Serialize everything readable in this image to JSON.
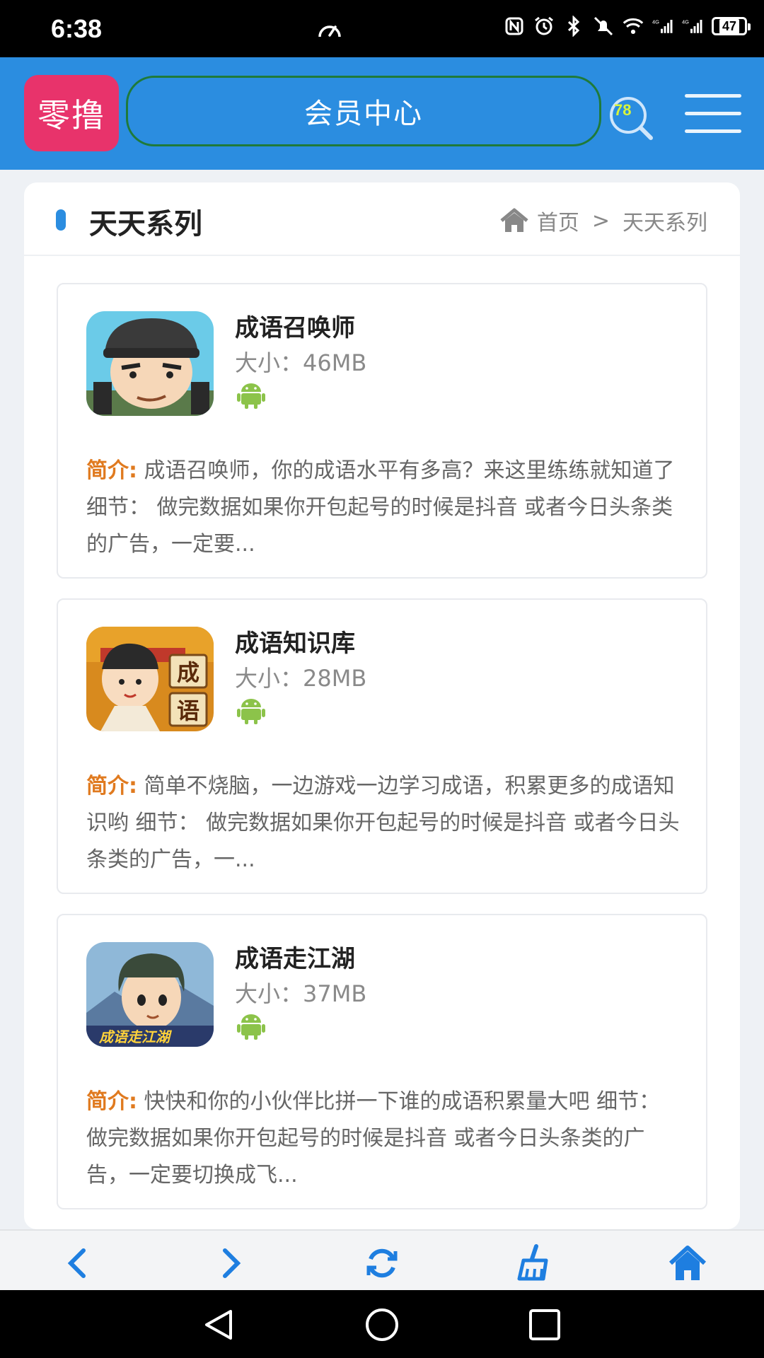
{
  "status_bar": {
    "time": "6:38",
    "battery": "47",
    "network": "4G"
  },
  "header": {
    "logo_text": "零撸",
    "member_center": "会员中心",
    "search_badge": "78"
  },
  "page": {
    "title": "天天系列",
    "breadcrumb": {
      "home": "首页",
      "separator": ">",
      "current": "天天系列"
    }
  },
  "apps": [
    {
      "name": "成语召唤师",
      "size": "大小：46MB",
      "platform_icon": "android-icon",
      "desc_label": "简介:",
      "desc": "成语召唤师，你的成语水平有多高？来这里练练就知道了 细节： 做完数据如果你开包起号的时候是抖音 或者今日头条类的广告，一定要..."
    },
    {
      "name": "成语知识库",
      "size": "大小：28MB",
      "platform_icon": "android-icon",
      "desc_label": "简介:",
      "desc": "简单不烧脑，一边游戏一边学习成语，积累更多的成语知识哟 细节： 做完数据如果你开包起号的时候是抖音 或者今日头条类的广告，一...",
      "thumb_chars": [
        "成",
        "语"
      ]
    },
    {
      "name": "成语走江湖",
      "size": "大小：37MB",
      "platform_icon": "android-icon",
      "desc_label": "简介:",
      "desc": "快快和你的小伙伴比拼一下谁的成语积累量大吧 细节： 做完数据如果你开包起号的时候是抖音 或者今日头条类的广告，一定要切换成飞...",
      "thumb_text": "成语走江湖"
    }
  ],
  "colors": {
    "header": "#2b8de0",
    "logo": "#e8336b",
    "accent": "#e07a1f",
    "bottom_icons": "#1e7ee0"
  }
}
